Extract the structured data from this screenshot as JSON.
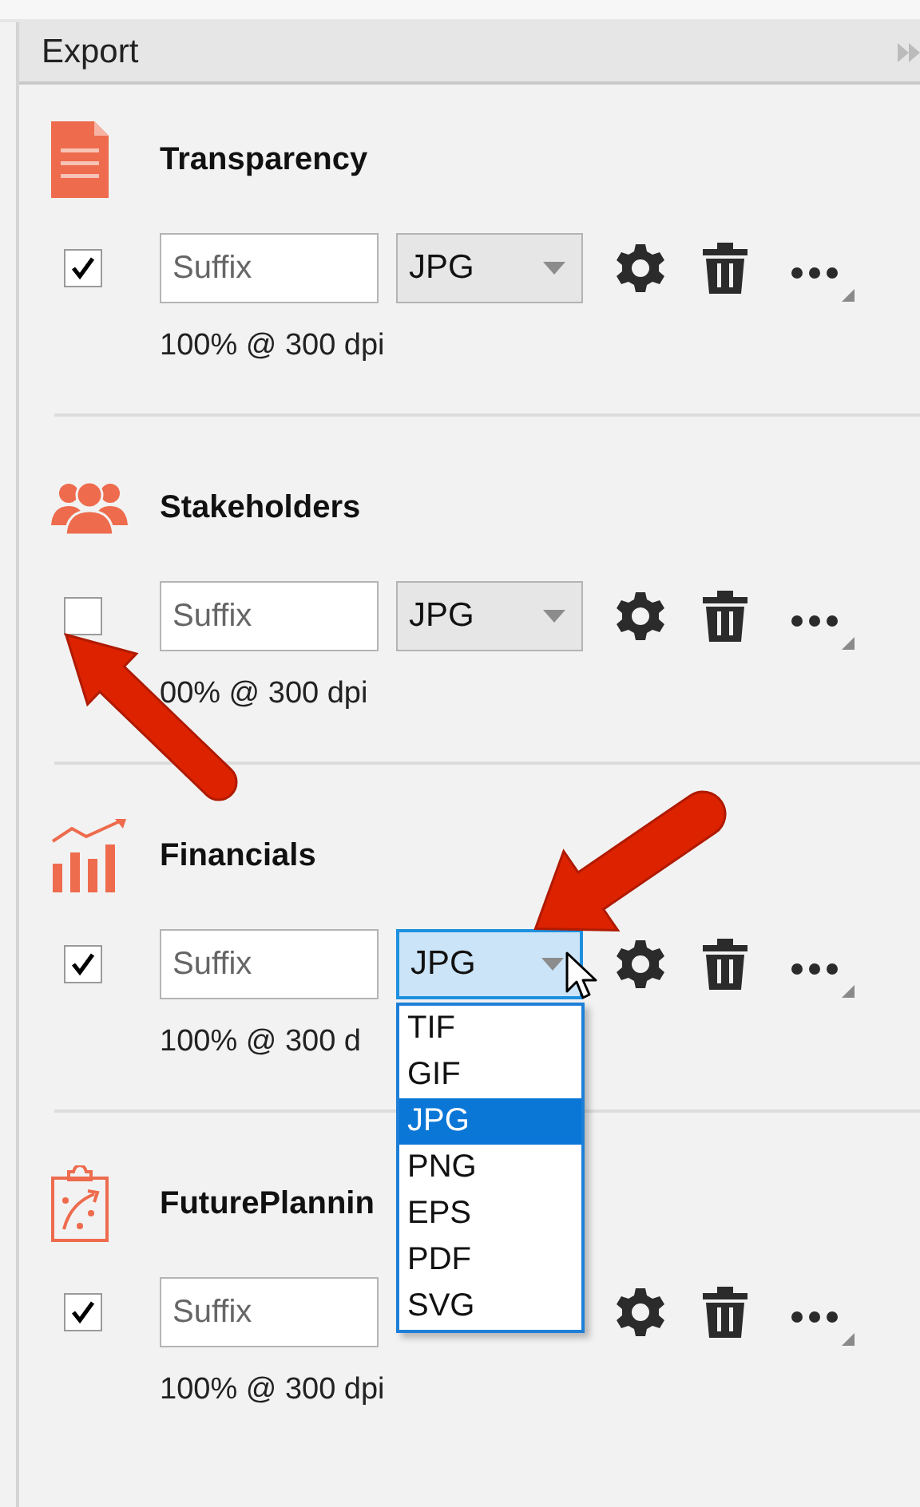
{
  "panel": {
    "title": "Export"
  },
  "sections": [
    {
      "kind": "document",
      "title": "Transparency",
      "checked": true,
      "placeholder": "Suffix",
      "format": "JPG",
      "open": false,
      "info": "100% @ 300 dpi"
    },
    {
      "kind": "people",
      "title": "Stakeholders",
      "checked": false,
      "placeholder": "Suffix",
      "format": "JPG",
      "open": false,
      "info": "00% @ 300 dpi"
    },
    {
      "kind": "chart",
      "title": "Financials",
      "checked": true,
      "placeholder": "Suffix",
      "format": "JPG",
      "open": true,
      "info": "100% @ 300 d",
      "options": [
        {
          "label": "TIF",
          "selected": false
        },
        {
          "label": "GIF",
          "selected": false
        },
        {
          "label": "JPG",
          "selected": true
        },
        {
          "label": "PNG",
          "selected": false
        },
        {
          "label": "EPS",
          "selected": false
        },
        {
          "label": "PDF",
          "selected": false
        },
        {
          "label": "SVG",
          "selected": false
        }
      ]
    },
    {
      "kind": "clipboard",
      "title": "FuturePlannin",
      "checked": true,
      "placeholder": "Suffix",
      "info": "100% @ 300 dpi"
    }
  ]
}
